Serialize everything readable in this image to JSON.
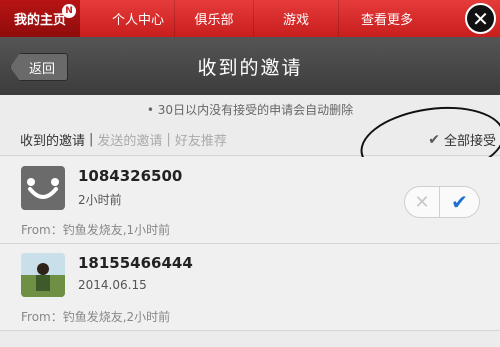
{
  "nav": {
    "items": [
      "我的主页",
      "个人中心",
      "俱乐部",
      "游戏",
      "查看更多"
    ],
    "home_badge": "N",
    "close_glyph": "✕"
  },
  "titlebar": {
    "back_label": "返回",
    "title": "收到的邀请"
  },
  "notice": "• 30日以内没有接受的申请会自动删除",
  "subtabs": {
    "received": "收到的邀请",
    "sent": "发送的邀请",
    "recommend": "好友推荐",
    "divider": "|",
    "accept_all": "全部接受",
    "accept_all_glyph": "✔"
  },
  "invites": [
    {
      "uid": "1084326500",
      "time": "2小时前",
      "from": "From：钓鱼发烧友,1小时前",
      "avatar": "default-avatar-icon",
      "show_actions": true,
      "reject_glyph": "✕",
      "accept_glyph": "✔"
    },
    {
      "uid": "18155466444",
      "time": "2014.06.15",
      "from": "From：钓鱼发烧友,2小时前",
      "avatar": "photo"
    }
  ],
  "colors": {
    "nav_red": "#c81e1e",
    "accept_blue": "#1f6fd1"
  }
}
